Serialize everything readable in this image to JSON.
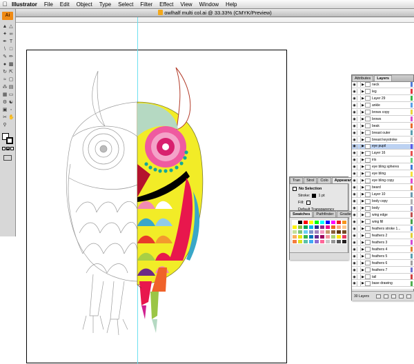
{
  "menubar": {
    "app_name": "Illustrator",
    "items": [
      "File",
      "Edit",
      "Object",
      "Type",
      "Select",
      "Filter",
      "Effect",
      "View",
      "Window",
      "Help"
    ]
  },
  "document": {
    "title": "owlhalf multi col.ai @ 33.33% (CMYK/Preview)"
  },
  "toolbox": {
    "logo_text": "Ai",
    "icons": [
      "selection-tool-icon",
      "direct-selection-tool-icon",
      "magic-wand-tool-icon",
      "lasso-tool-icon",
      "pen-tool-icon",
      "type-tool-icon",
      "line-tool-icon",
      "rectangle-tool-icon",
      "paintbrush-tool-icon",
      "pencil-tool-icon",
      "blob-brush-tool-icon",
      "eraser-tool-icon",
      "rotate-tool-icon",
      "scale-tool-icon",
      "warp-tool-icon",
      "free-transform-tool-icon",
      "symbol-sprayer-tool-icon",
      "graph-tool-icon",
      "mesh-tool-icon",
      "gradient-tool-icon",
      "eyedropper-tool-icon",
      "blend-tool-icon",
      "live-paint-tool-icon",
      "slice-tool-icon",
      "scissors-tool-icon",
      "hand-tool-icon",
      "zoom-tool-icon"
    ]
  },
  "layers_panel": {
    "tabs": [
      "Attributes",
      "Layers"
    ],
    "layers": [
      {
        "name": "neck",
        "color": "#4f7bd9"
      },
      {
        "name": "leg",
        "color": "#e2363e"
      },
      {
        "name": "Layer 29",
        "color": "#38b84a"
      },
      {
        "name": "ankle",
        "color": "#5aa0e8"
      },
      {
        "name": "brows copy",
        "color": "#e8d53c"
      },
      {
        "name": "brows",
        "color": "#d94fd0"
      },
      {
        "name": "beak",
        "color": "#e86a2c"
      },
      {
        "name": "breast outer",
        "color": "#5a9fb0"
      },
      {
        "name": "breast keystroke",
        "color": "#c0c0c0"
      },
      {
        "name": "eye pupil",
        "color": "#5a5ae8"
      },
      {
        "name": "Layer 16",
        "color": "#e85050"
      },
      {
        "name": "iris",
        "color": "#6ad07a"
      },
      {
        "name": "eye bling spheres",
        "color": "#3c78d8"
      },
      {
        "name": "eye bling",
        "color": "#f5e23c"
      },
      {
        "name": "eye bling copy",
        "color": "#e04ad0"
      },
      {
        "name": "beard",
        "color": "#e4862e"
      },
      {
        "name": "Layer 10",
        "color": "#6a9ab0"
      },
      {
        "name": "body copy",
        "color": "#b0b0b0"
      },
      {
        "name": "body",
        "color": "#9090c8"
      },
      {
        "name": "wing edge",
        "color": "#c05050"
      },
      {
        "name": "wing fill",
        "color": "#48a048"
      },
      {
        "name": "feathers stroke 1...",
        "color": "#4c8ee0"
      },
      {
        "name": "feathers 2",
        "color": "#e0cf38"
      },
      {
        "name": "feathers 3",
        "color": "#d04ad4"
      },
      {
        "name": "feathers 4",
        "color": "#e08030"
      },
      {
        "name": "feathers 5",
        "color": "#5aa0b0"
      },
      {
        "name": "feathers 6",
        "color": "#a0a0a0"
      },
      {
        "name": "feathers 7",
        "color": "#7070d0"
      },
      {
        "name": "tail",
        "color": "#d04040"
      },
      {
        "name": "base drawing",
        "color": "#50b050"
      }
    ],
    "selected_layer": "eye pupil",
    "layer_count": "30 Layers"
  },
  "appearance_panel": {
    "tabs": [
      "Tran",
      "Strol",
      "Colo",
      "Appearance"
    ],
    "selection": "No Selection",
    "stroke_label": "Stroke:",
    "stroke_weight": "1 pt",
    "fill_label": "Fill:",
    "transparency": "Default Transparency"
  },
  "swatches_panel": {
    "tabs": [
      "Swatches",
      "Pathfinder",
      "Gradient"
    ],
    "colors": [
      "#ffffff",
      "#000000",
      "#ff0000",
      "#ffff00",
      "#00ff00",
      "#00ffff",
      "#0000ff",
      "#ff00ff",
      "#ed1c24",
      "#f7941d",
      "#fff200",
      "#8dc63f",
      "#00a651",
      "#00aeef",
      "#2e3192",
      "#92278f",
      "#ec008c",
      "#f26522",
      "#f9ad81",
      "#fdc689",
      "#c4df9b",
      "#7cc576",
      "#6dcff6",
      "#8393ca",
      "#a186be",
      "#f49ac1",
      "#c69c6d",
      "#8c6239",
      "#603913",
      "#754c24",
      "#fbaf5d",
      "#ebe20e",
      "#39b54a",
      "#0072bc",
      "#662d91",
      "#9e005d",
      "#f5989d",
      "#acd373",
      "#ffe600",
      "#e63c5f",
      "#f47c3c",
      "#d9e021",
      "#5bc2a8",
      "#3fa9f5",
      "#8c6cd1",
      "#ff6699",
      "#c8c8c8",
      "#959595",
      "#555555",
      "#231f20"
    ]
  }
}
